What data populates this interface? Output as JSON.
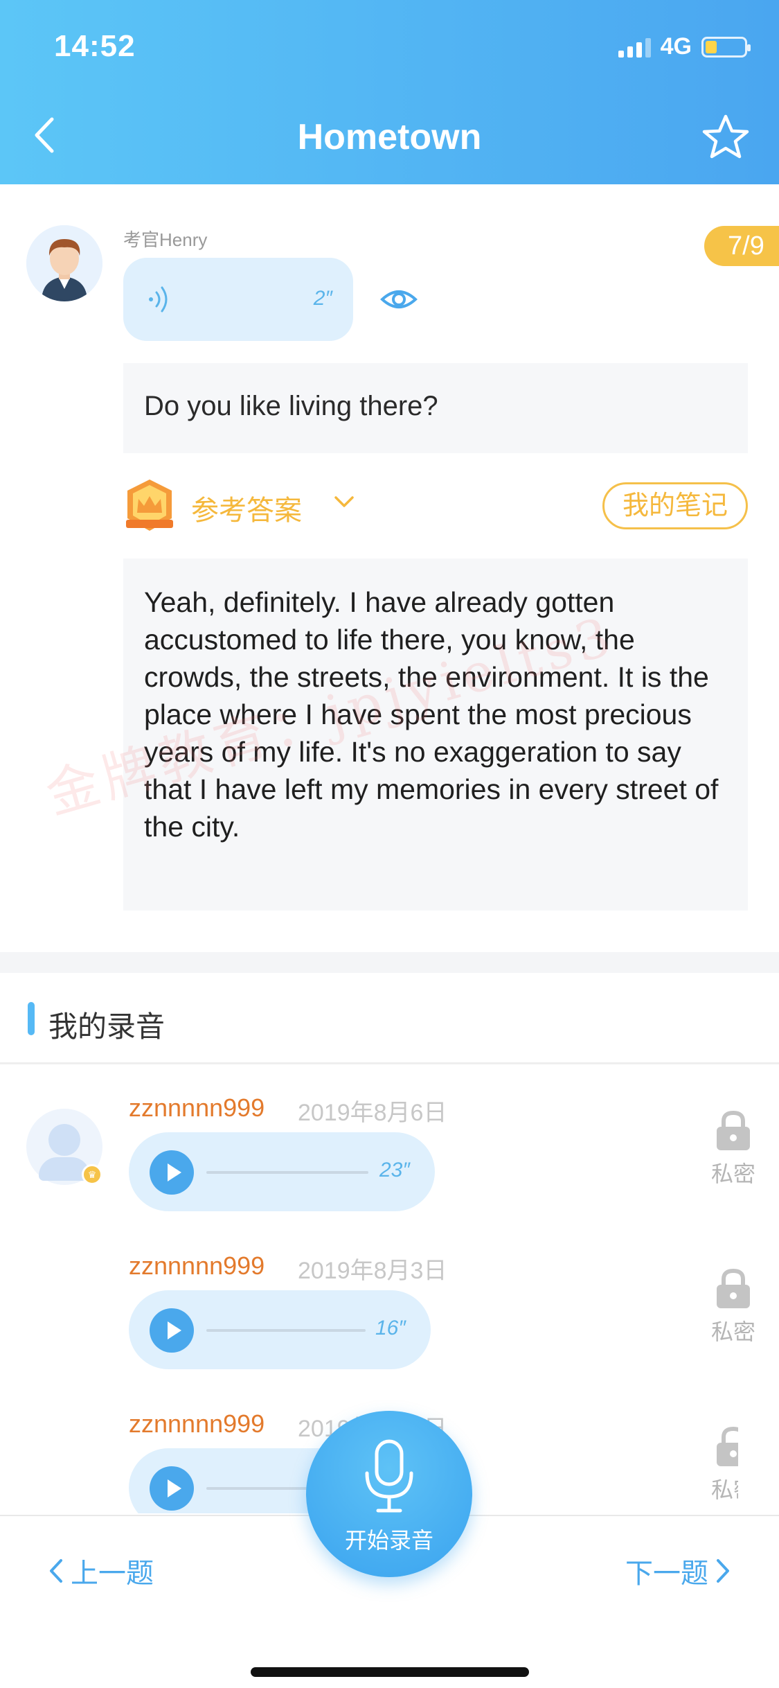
{
  "status_bar": {
    "time": "14:52",
    "network": "4G"
  },
  "header": {
    "title": "Hometown"
  },
  "examiner": {
    "name": "考官Henry",
    "voice_duration": "2″",
    "progress": "7/9"
  },
  "question": {
    "text": "Do you like living there?"
  },
  "reference": {
    "label": "参考答案",
    "notes_button": "我的笔记",
    "answer": "Yeah, definitely. I have already gotten accustomed to life there, you know, the crowds, the streets, the environment. It is the place where I have spent the most precious years of my life. It's no exaggeration to say that I have left my memories in every street of the city.",
    "watermark": "金牌教育：jpjyielts3"
  },
  "recordings": {
    "section_title": "我的录音",
    "items": [
      {
        "user": "zznnnnn999",
        "date": "2019年8月6日",
        "duration": "23″",
        "privacy": "私密"
      },
      {
        "user": "zznnnnn999",
        "date": "2019年8月3日",
        "duration": "16″",
        "privacy": "私密"
      },
      {
        "user": "zznnnnn999",
        "date": "2019年8月3日",
        "duration": "",
        "privacy": "私密"
      }
    ]
  },
  "bottom_nav": {
    "prev": "上一题",
    "next": "下一题",
    "record": "开始录音"
  },
  "colors": {
    "header_blue": "#4aa6f0",
    "accent_orange": "#f5b83c",
    "username_orange": "#e37a2c",
    "player_bg": "#dff0fd"
  }
}
